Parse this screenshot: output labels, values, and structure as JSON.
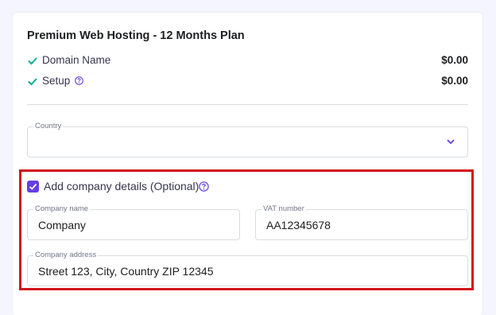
{
  "plan": {
    "title": "Premium Web Hosting - 12 Months Plan",
    "items": [
      {
        "label": "Domain Name",
        "price": "$0.00",
        "icon": "check-icon",
        "help": false
      },
      {
        "label": "Setup",
        "price": "$0.00",
        "icon": "check-icon",
        "help": true
      }
    ]
  },
  "country": {
    "label": "Country",
    "value": "",
    "icon": "chevron-down-icon"
  },
  "company": {
    "checkbox_label": "Add company details (Optional)",
    "checked": true,
    "help_icon": "question-circle-icon",
    "name_label": "Company name",
    "name_value": "Company",
    "vat_label": "VAT number",
    "vat_value": "AA12345678",
    "address_label": "Company address",
    "address_value": "Street 123, City, Country ZIP 12345"
  },
  "colors": {
    "accent": "#673de6",
    "check": "#00b090",
    "highlight_border": "#d3101a"
  }
}
